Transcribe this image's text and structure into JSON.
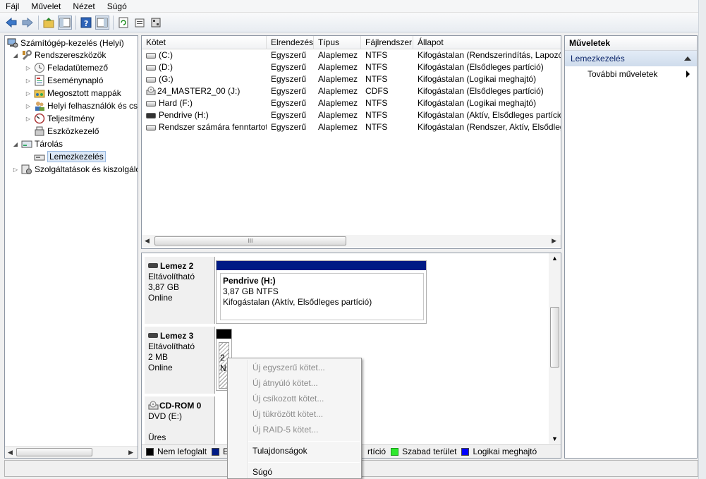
{
  "menu": [
    "Fájl",
    "Művelet",
    "Nézet",
    "Súgó"
  ],
  "tree": {
    "root": "Számítógép-kezelés (Helyi)",
    "items": [
      {
        "label": "Rendszereszközök",
        "level": 1,
        "expander": "◢"
      },
      {
        "label": "Feladatütemező",
        "level": 2,
        "expander": "▷"
      },
      {
        "label": "Eseménynapló",
        "level": 2,
        "expander": "▷"
      },
      {
        "label": "Megosztott mappák",
        "level": 2,
        "expander": "▷"
      },
      {
        "label": "Helyi felhasználók és cs",
        "level": 2,
        "expander": "▷"
      },
      {
        "label": "Teljesítmény",
        "level": 2,
        "expander": "▷"
      },
      {
        "label": "Eszközkezelő",
        "level": 2,
        "expander": ""
      },
      {
        "label": "Tárolás",
        "level": 1,
        "expander": "◢"
      },
      {
        "label": "Lemezkezelés",
        "level": 2,
        "expander": ""
      },
      {
        "label": "Szolgáltatások és kiszolgáló",
        "level": 1,
        "expander": "▷"
      }
    ]
  },
  "volumes": {
    "headers": [
      "Kötet",
      "Elrendezés",
      "Típus",
      "Fájlrendszer",
      "Állapot"
    ],
    "rows": [
      [
        "(C:)",
        "Egyszerű",
        "Alaplemez",
        "NTFS",
        "Kifogástalan (Rendszerindítás, Lapozóf"
      ],
      [
        "(D:)",
        "Egyszerű",
        "Alaplemez",
        "NTFS",
        "Kifogástalan (Elsődleges partíció)"
      ],
      [
        "(G:)",
        "Egyszerű",
        "Alaplemez",
        "NTFS",
        "Kifogástalan (Logikai meghajtó)"
      ],
      [
        "24_MASTER2_00 (J:)",
        "Egyszerű",
        "Alaplemez",
        "CDFS",
        "Kifogástalan (Elsődleges partíció)"
      ],
      [
        "Hard (F:)",
        "Egyszerű",
        "Alaplemez",
        "NTFS",
        "Kifogástalan (Logikai meghajtó)"
      ],
      [
        "Pendrive (H:)",
        "Egyszerű",
        "Alaplemez",
        "NTFS",
        "Kifogástalan (Aktív, Elsődleges partíció"
      ],
      [
        "Rendszer számára fenntartott",
        "Egyszerű",
        "Alaplemez",
        "NTFS",
        "Kifogástalan (Rendszer, Aktív, Elsődleg"
      ]
    ],
    "scroll_grip": "III"
  },
  "disks": [
    {
      "name": "Lemez 2",
      "type": "Eltávolítható",
      "size": "3,87 GB",
      "status": "Online",
      "partition": {
        "title": "Pendrive  (H:)",
        "line2": "3,87 GB NTFS",
        "line3": "Kifogástalan (Aktív, Elsődleges partíció)"
      }
    },
    {
      "name": "Lemez 3",
      "type": "Eltávolítható",
      "size": "2 MB",
      "status": "Online",
      "partition": {
        "line1": "2",
        "line2": "N"
      }
    },
    {
      "name": "CD-ROM 0",
      "type": "DVD (E:)",
      "size": "",
      "status": "Üres"
    }
  ],
  "legend": [
    {
      "label": "Nem lefoglalt",
      "color": "#000000"
    },
    {
      "label": "E",
      "color": "#001b85"
    },
    {
      "label": "rtíció",
      "color": ""
    },
    {
      "label": "Szabad terület",
      "color": "#2ee82e"
    },
    {
      "label": "Logikai meghajtó",
      "color": "#0000ff"
    }
  ],
  "actions": {
    "title": "Műveletek",
    "section": "Lemezkezelés",
    "item": "További műveletek"
  },
  "context_menu": {
    "disabled": [
      "Új egyszerű kötet...",
      "Új átnyúló kötet...",
      "Új csíkozott kötet...",
      "Új tükrözött kötet...",
      "Új RAID-5 kötet..."
    ],
    "properties": "Tulajdonságok",
    "help": "Súgó"
  }
}
